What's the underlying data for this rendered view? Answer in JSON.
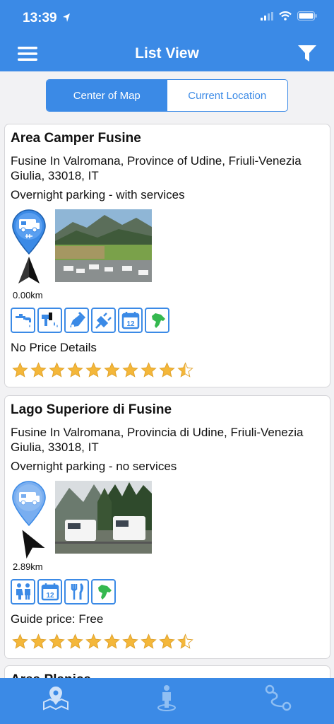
{
  "status_bar": {
    "time": "13:39"
  },
  "header": {
    "title": "List View"
  },
  "segmented": {
    "options": [
      "Center of Map",
      "Current Location"
    ],
    "selected": "Center of Map"
  },
  "listings": [
    {
      "name": "Area Camper Fusine",
      "address": "Fusine In Valromana, Province of Udine, Friuli-Venezia Giulia, 33018, IT",
      "type": "Overnight parking - with services",
      "distance": "0.00km",
      "price": "No Price Details",
      "rating": 9.5,
      "amenities": [
        "water-tap-icon",
        "drain-icon",
        "chemical-toilet-icon",
        "electricity-icon",
        "open-all-year-icon",
        "pets-allowed-icon"
      ]
    },
    {
      "name": "Lago Superiore di Fusine",
      "address": "Fusine In Valromana, Provincia di Udine, Friuli-Venezia Giulia, 33018, IT",
      "type": "Overnight parking - no services",
      "distance": "2.89km",
      "price": "Guide price: Free",
      "rating": 9.5,
      "amenities": [
        "toilets-icon",
        "open-all-year-icon",
        "restaurant-icon",
        "pets-allowed-icon"
      ]
    },
    {
      "name": "Area Planica"
    }
  ],
  "colors": {
    "brand": "#3b8ae6",
    "star": "#f4b73a",
    "pet": "#35b84f"
  },
  "tabbar": {
    "items": [
      "map-icon",
      "person-location-icon",
      "route-icon"
    ]
  }
}
